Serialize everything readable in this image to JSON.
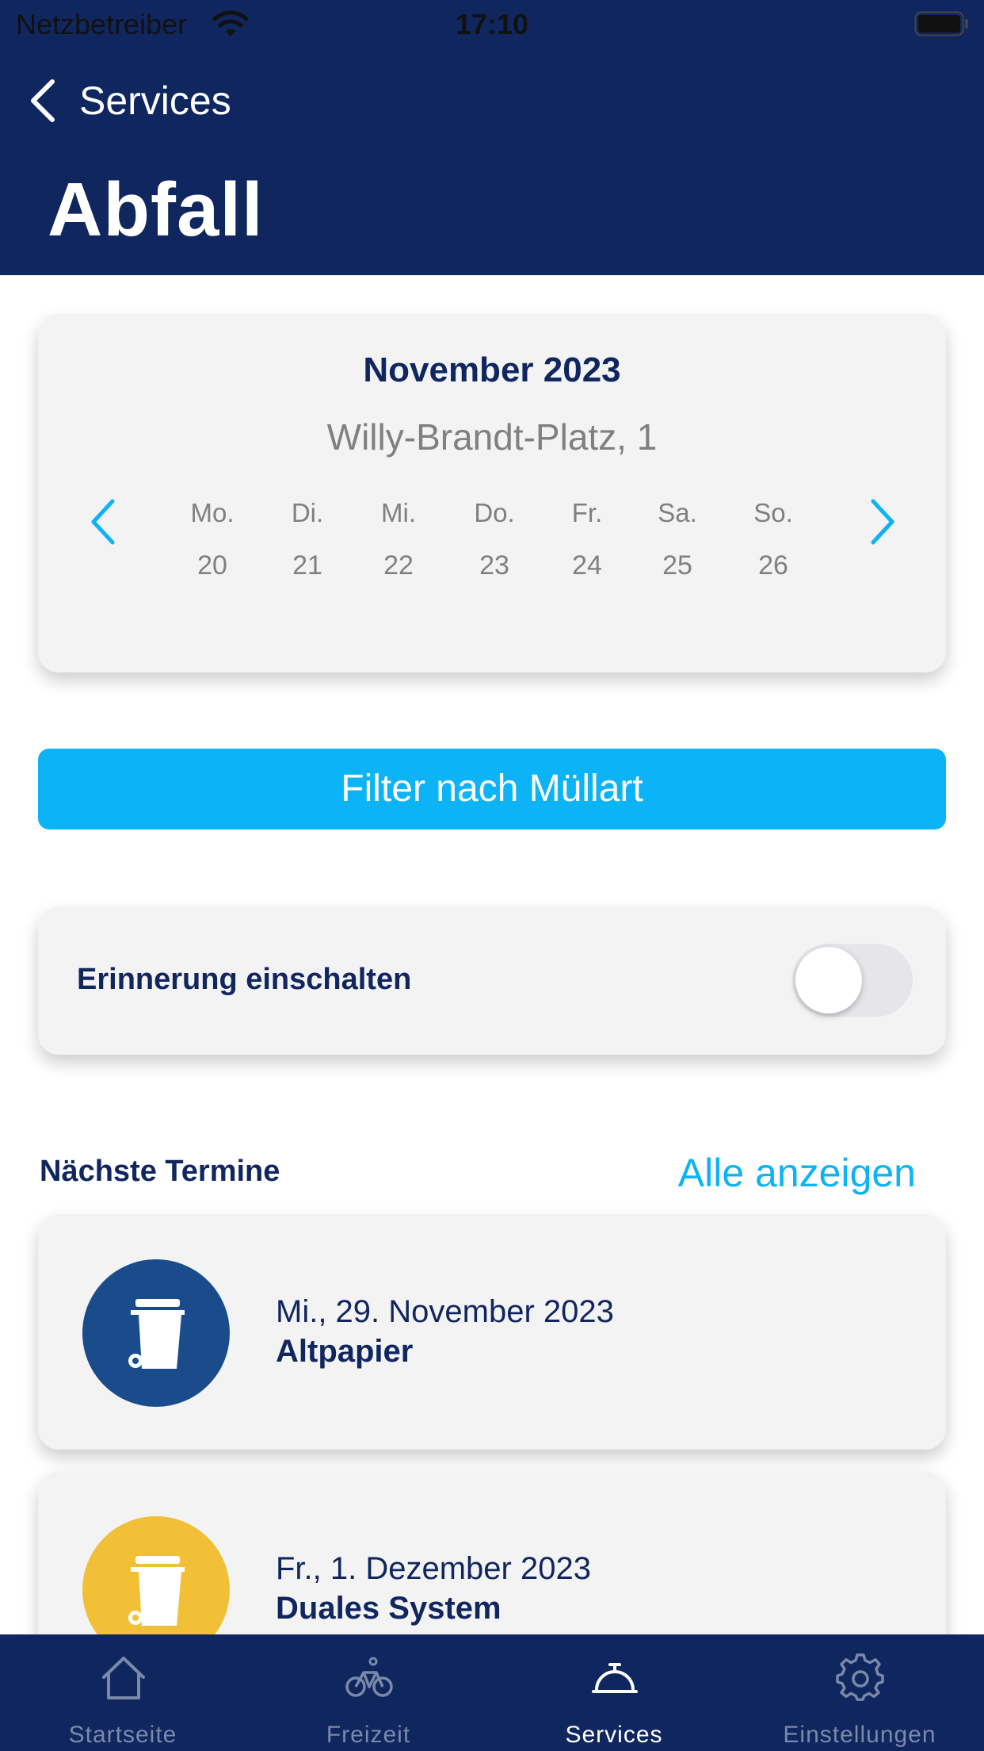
{
  "status_bar": {
    "carrier": "Netzbetreiber",
    "time": "17:10",
    "wifi_icon": "wifi-icon",
    "battery_icon": "battery-icon"
  },
  "header": {
    "back_label": "Services",
    "title": "Abfall",
    "background_color": "#10265f"
  },
  "calendar": {
    "month": "November 2023",
    "address": "Willy-Brandt-Platz, 1",
    "prev_icon": "chevron-left-icon",
    "next_icon": "chevron-right-icon",
    "days": [
      {
        "name": "Mo.",
        "date": "20"
      },
      {
        "name": "Di.",
        "date": "21"
      },
      {
        "name": "Mi.",
        "date": "22"
      },
      {
        "name": "Do.",
        "date": "23"
      },
      {
        "name": "Fr.",
        "date": "24"
      },
      {
        "name": "Sa.",
        "date": "25"
      },
      {
        "name": "So.",
        "date": "26"
      }
    ]
  },
  "filter": {
    "label": "Filter nach Müllart",
    "color": "#0cb3f6"
  },
  "reminder": {
    "label": "Erinnerung einschalten",
    "enabled": false
  },
  "upcoming": {
    "title": "Nächste Termine",
    "show_all": "Alle anzeigen",
    "events": [
      {
        "date": "Mi., 29. November 2023",
        "type": "Altpapier",
        "color": "#1a4c8c",
        "icon": "trash-bin-icon"
      },
      {
        "date": "Fr., 1. Dezember 2023",
        "type": "Duales System",
        "color": "#f2c037",
        "icon": "trash-bin-icon"
      }
    ]
  },
  "tab_bar": {
    "tabs": [
      {
        "label": "Startseite",
        "icon": "home-icon",
        "active": false
      },
      {
        "label": "Freizeit",
        "icon": "bicycle-icon",
        "active": false
      },
      {
        "label": "Services",
        "icon": "service-bell-icon",
        "active": true
      },
      {
        "label": "Einstellungen",
        "icon": "gear-icon",
        "active": false
      }
    ]
  }
}
